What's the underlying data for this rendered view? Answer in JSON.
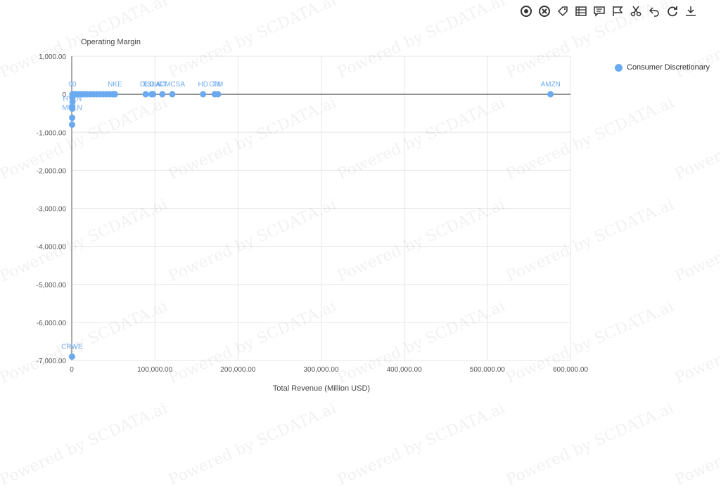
{
  "toolbar": {
    "items": [
      "target-icon",
      "close-circle-icon",
      "tag-icon",
      "data-view-icon",
      "comment-icon",
      "flag-icon",
      "scissors-icon",
      "undo-icon",
      "refresh-icon",
      "download-icon"
    ]
  },
  "watermark": "Powered by SCDATA.ai",
  "chart_data": {
    "type": "scatter",
    "title": "",
    "xlabel": "Total Revenue (Million USD)",
    "ylabel": "Operating Margin",
    "xlim": [
      0,
      600000
    ],
    "ylim": [
      -7000,
      1000
    ],
    "xticks": [
      "0",
      "100,000.00",
      "200,000.00",
      "300,000.00",
      "400,000.00",
      "500,000.00",
      "600,000.00"
    ],
    "yticks": [
      "1,000.00",
      "0",
      "-1,000.00",
      "-2,000.00",
      "-3,000.00",
      "-4,000.00",
      "-5,000.00",
      "-6,000.00",
      "-7,000.00"
    ],
    "grid": true,
    "legend_position": "top-right",
    "color": "#6baaf0",
    "series": [
      {
        "name": "Consumer Discretionary",
        "points": [
          {
            "x": 576000,
            "y": 0,
            "label": "AMZN"
          },
          {
            "x": 176000,
            "y": 0,
            "label": "TM"
          },
          {
            "x": 172000,
            "y": 0,
            "label": "GM"
          },
          {
            "x": 158000,
            "y": 0,
            "label": "HD"
          },
          {
            "x": 121000,
            "y": 0,
            "label": "CMCSA"
          },
          {
            "x": 109000,
            "y": 0,
            "label": "GT"
          },
          {
            "x": 98000,
            "y": 0,
            "label": "LOW"
          },
          {
            "x": 96000,
            "y": 0,
            "label": "TSLA"
          },
          {
            "x": 89000,
            "y": 0,
            "label": "DIS"
          },
          {
            "x": 52000,
            "y": 0,
            "label": "NKE"
          },
          {
            "x": 50000,
            "y": 0,
            "label": ""
          },
          {
            "x": 46000,
            "y": 0,
            "label": ""
          },
          {
            "x": 42000,
            "y": 0,
            "label": ""
          },
          {
            "x": 38000,
            "y": 0,
            "label": ""
          },
          {
            "x": 34000,
            "y": 0,
            "label": ""
          },
          {
            "x": 30000,
            "y": 0,
            "label": ""
          },
          {
            "x": 26000,
            "y": 0,
            "label": ""
          },
          {
            "x": 22000,
            "y": 0,
            "label": ""
          },
          {
            "x": 18000,
            "y": 0,
            "label": ""
          },
          {
            "x": 15000,
            "y": 0,
            "label": ""
          },
          {
            "x": 12000,
            "y": 0,
            "label": ""
          },
          {
            "x": 9000,
            "y": 0,
            "label": ""
          },
          {
            "x": 6000,
            "y": 0,
            "label": ""
          },
          {
            "x": 4000,
            "y": 0,
            "label": ""
          },
          {
            "x": 2500,
            "y": 0,
            "label": ""
          },
          {
            "x": 1500,
            "y": 0,
            "label": ""
          },
          {
            "x": 800,
            "y": 0,
            "label": "90"
          },
          {
            "x": 800,
            "y": -100,
            "label": ""
          },
          {
            "x": 900,
            "y": -200,
            "label": ""
          },
          {
            "x": 700,
            "y": -320,
            "label": ""
          },
          {
            "x": 600,
            "y": -380,
            "label": "HYLN"
          },
          {
            "x": 500,
            "y": -620,
            "label": "MULN"
          },
          {
            "x": 400,
            "y": -800,
            "label": ""
          },
          {
            "x": 300,
            "y": -6900,
            "label": "CRWE"
          }
        ]
      }
    ]
  }
}
